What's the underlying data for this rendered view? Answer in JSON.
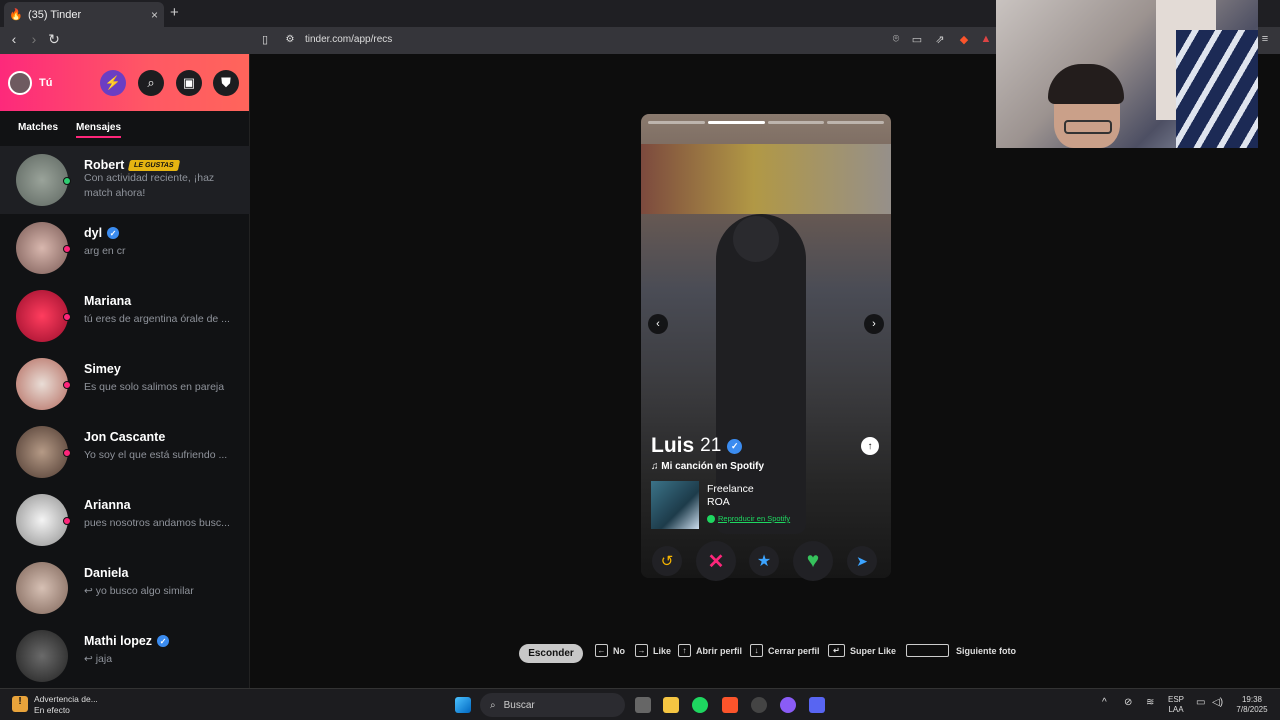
{
  "browser": {
    "tab_title": "(35) Tinder",
    "tab_close": "×",
    "new_tab": "+",
    "url": "tinder.com/app/recs"
  },
  "sidebar": {
    "profile_label": "Tú",
    "tabs": [
      "Matches",
      "Mensajes"
    ],
    "active_tab": "Mensajes",
    "messages": [
      {
        "name": "Robert",
        "badge": "LE GUSTAS",
        "verified": false,
        "text": "Con actividad reciente, ¡haz match ahora!",
        "status_color": "#2ecc71"
      },
      {
        "name": "dyl",
        "verified": true,
        "text": "arg en cr",
        "status_color": "#fd267a"
      },
      {
        "name": "Mariana",
        "verified": false,
        "text": "tú eres de argentina órale de ...",
        "status_color": "#fd267a"
      },
      {
        "name": "Simey",
        "verified": false,
        "text": "Es que solo salimos en pareja",
        "status_color": "#fd267a"
      },
      {
        "name": "Jon Cascante",
        "verified": false,
        "text": "Yo soy el que está sufriendo ...",
        "status_color": "#fd267a"
      },
      {
        "name": "Arianna",
        "verified": false,
        "text": "pues nosotros andamos busc...",
        "status_color": "#fd267a"
      },
      {
        "name": "Daniela",
        "verified": false,
        "text": "↩ yo busco algo similar",
        "status_color": null
      },
      {
        "name": "Mathi lopez",
        "verified": true,
        "text": "↩ jaja",
        "status_color": null
      }
    ]
  },
  "card": {
    "name": "Luis",
    "age": "21",
    "verified": true,
    "song_heading": "Mi canción en Spotify",
    "song_title": "Freelance",
    "song_artist": "ROA",
    "spotify_link": "Reproducir en Spotify",
    "photo_count": 4,
    "active_photo": 1
  },
  "actions": {
    "rewind": "↺",
    "nope": "✕",
    "superlike": "★",
    "like": "♥",
    "boost": "➤"
  },
  "shortcuts": {
    "hide": "Esconder",
    "items": [
      {
        "key": "←",
        "label": "No"
      },
      {
        "key": "→",
        "label": "Like"
      },
      {
        "key": "↑",
        "label": "Abrir perfil"
      },
      {
        "key": "↓",
        "label": "Cerrar perfil"
      },
      {
        "key": "↵",
        "label": "Super Like"
      },
      {
        "key": "",
        "label": "Siguiente foto"
      }
    ]
  },
  "taskbar": {
    "warning_title": "Advertencia de...",
    "warning_sub": "En efecto",
    "search_placeholder": "Buscar",
    "lang1": "ESP",
    "lang2": "LAA",
    "time": "19:38",
    "date": "7/8/2025"
  },
  "colors": {
    "brand_gradient_start": "#fd297b",
    "brand_gradient_end": "#ff655b",
    "like_green": "#36c25c",
    "nope_pink": "#fd267a",
    "superlike_blue": "#3ca4ff",
    "rewind_yellow": "#f5b400",
    "spotify_green": "#1ed760"
  }
}
